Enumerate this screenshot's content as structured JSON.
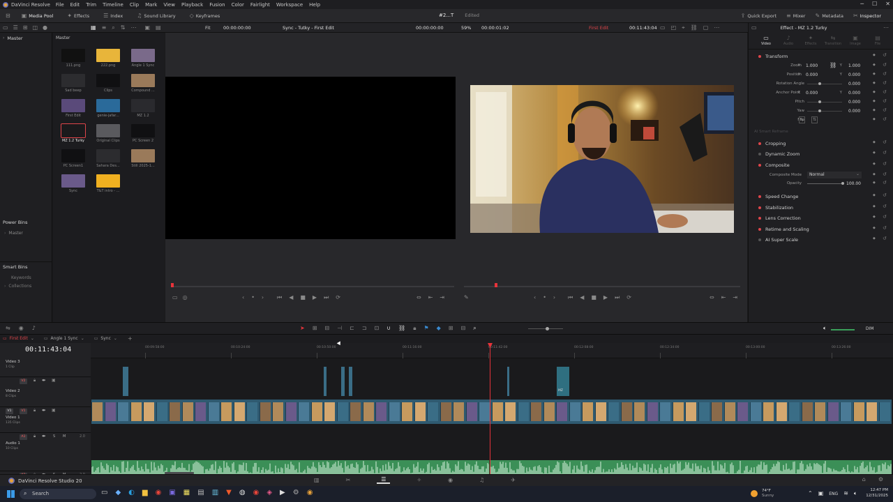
{
  "titlebar": {
    "app_name": "DaVinci Resolve",
    "menu": [
      "File",
      "Edit",
      "Trim",
      "Timeline",
      "Clip",
      "Mark",
      "View",
      "Playback",
      "Fusion",
      "Color",
      "Fairlight",
      "Workspace",
      "Help"
    ]
  },
  "modules": {
    "left": [
      {
        "label": "Media Pool",
        "icon": "media-pool-icon",
        "active": true
      },
      {
        "label": "Effects",
        "icon": "effects-icon"
      },
      {
        "label": "Index",
        "icon": "index-icon"
      },
      {
        "label": "Sound Library",
        "icon": "sound-library-icon"
      },
      {
        "label": "Keyframes",
        "icon": "keyframes-icon"
      }
    ],
    "project_name": "#2...T",
    "project_status": "Edited",
    "right": [
      {
        "label": "Quick Export",
        "icon": "export-icon"
      },
      {
        "label": "Mixer",
        "icon": "mixer-icon"
      },
      {
        "label": "Metadata",
        "icon": "metadata-icon"
      },
      {
        "label": "Inspector",
        "icon": "inspector-icon",
        "active": true
      }
    ]
  },
  "viewer": {
    "fit_label": "Fit",
    "source_timecode": "00:00:00:00",
    "source_clip_name": "Sync - Tutky - First Edit",
    "source_duration": "00:00:00:00",
    "zoom": "59%",
    "program_duration": "00:00:01:02",
    "timeline_name": "First Edit",
    "program_timecode": "00:11:43:04"
  },
  "bins": {
    "master_label": "Master",
    "power_bins_title": "Power Bins",
    "power_bins_master": "Master",
    "smart_bins_title": "Smart Bins",
    "smart_keywords": "Keywords",
    "smart_collections": "Collections",
    "pool_header": "Master"
  },
  "media_pool_clips": [
    {
      "name": "111.png",
      "color": "#111"
    },
    {
      "name": "222.png",
      "color": "#e8b53a"
    },
    {
      "name": "Angle 1 Sync",
      "color": "#7a6a8a"
    },
    {
      "name": "Sad beep",
      "color": "#2c2c2f"
    },
    {
      "name": "Clips",
      "color": "#101012"
    },
    {
      "name": "Compound ...",
      "color": "#9a7a5a"
    },
    {
      "name": "First Edit",
      "color": "#5a4a7a"
    },
    {
      "name": "genie-jafar...",
      "color": "#2a6a9a"
    },
    {
      "name": "MZ 1.2",
      "color": "#2a2a2e"
    },
    {
      "name": "MZ 1.2 Turky",
      "color": "#1a1a1c"
    },
    {
      "name": "Original Clips",
      "color": "#5a5a5e"
    },
    {
      "name": "PC Screen 2",
      "color": "#101012"
    },
    {
      "name": "PC Screen1",
      "color": "#101012"
    },
    {
      "name": "Sahara Des...",
      "color": "#2c2c2f"
    },
    {
      "name": "Still 2025-1...",
      "color": "#9a7a5a"
    },
    {
      "name": "Sync",
      "color": "#6a5a8a"
    },
    {
      "name": "T&T intro - ...",
      "color": "#f0b020"
    }
  ],
  "inspector": {
    "title": "Effect - MZ 1.2 Turky",
    "tabs": [
      "Video",
      "Audio",
      "Effects",
      "Transition",
      "Image",
      "File"
    ],
    "transform_title": "Transform",
    "zoom_label": "Zoom",
    "zoom_x": "1.000",
    "zoom_y": "1.000",
    "position_label": "Position",
    "position_x": "0.000",
    "position_y": "0.000",
    "rotation_label": "Rotation Angle",
    "rotation_value": "0.000",
    "anchor_label": "Anchor Point",
    "anchor_x": "0.000",
    "anchor_y": "0.000",
    "pitch_label": "Pitch",
    "pitch_value": "0.000",
    "yaw_label": "Yaw",
    "yaw_value": "0.000",
    "flip_label": "Flip",
    "smart_reframe": "AI Smart Reframe",
    "cropping": "Cropping",
    "dynamic_zoom": "Dynamic Zoom",
    "composite": "Composite",
    "composite_mode_label": "Composite Mode",
    "composite_mode_value": "Normal",
    "opacity_label": "Opacity",
    "opacity_value": "100.00",
    "speed_change": "Speed Change",
    "stabilization": "Stabilization",
    "lens_correction": "Lens Correction",
    "retime_scaling": "Retime and Scaling",
    "ai_super_scale": "AI Super Scale"
  },
  "timeline": {
    "tabs": [
      "First Edit",
      "Angle 1 Sync",
      "Sync"
    ],
    "timecode": "00:11:43:04",
    "ruler": [
      "00:09:58:00",
      "00:10:24:00",
      "00:10:50:00",
      "00:11:16:00",
      "00:11:42:00",
      "00:12:08:00",
      "00:12:34:00",
      "00:13:00:00",
      "00:13:26:00"
    ],
    "dim_label": "DIM",
    "tracks": [
      {
        "id": "V3",
        "name": "Video 3",
        "sub": "1 Clip"
      },
      {
        "id": "V2",
        "name": "Video 2",
        "sub": "8 Clips"
      },
      {
        "id": "V1",
        "name": "Video 1",
        "sub": "135 Clips"
      },
      {
        "id": "A1",
        "name": "Audio 1",
        "sub": "10 Clips",
        "level": "2.0"
      },
      {
        "id": "A2",
        "name": "",
        "sub": "",
        "level": "2.0"
      }
    ],
    "audio_clip_label_1": "Sync - Talal",
    "audio_clip_label_2": "Sync - Talal",
    "v2_clip_label": "MZ"
  },
  "pagebar": {
    "product": "DaVinci Resolve Studio 20",
    "pages": [
      "media-page-icon",
      "cut-page-icon",
      "edit-page-icon",
      "fusion-page-icon",
      "color-page-icon",
      "fairlight-page-icon",
      "deliver-page-icon"
    ]
  },
  "taskbar": {
    "search_placeholder": "Search",
    "weather_temp": "74°F",
    "weather_cond": "Sunny",
    "lang": "ENG",
    "time": "12:47 PM",
    "date": "12/31/2025"
  },
  "colors": {
    "accent_red": "#e0454a",
    "clip_blue": "#3a6d86",
    "audio_green": "#3b8f57",
    "playhead": "#e8333a"
  }
}
